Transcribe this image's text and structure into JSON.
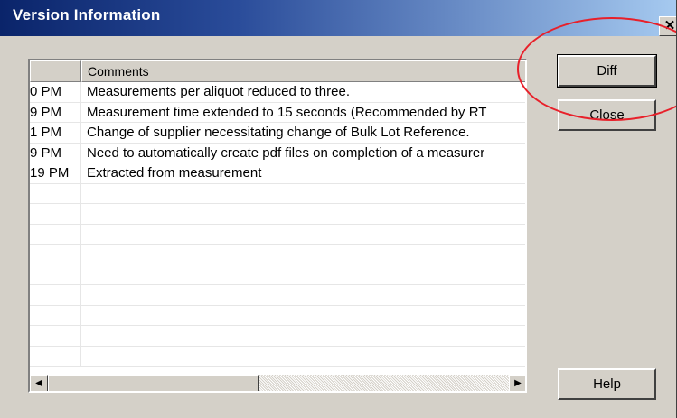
{
  "window": {
    "title": "Version Information",
    "close_glyph": "✕"
  },
  "list": {
    "columns": [
      "",
      "Comments"
    ],
    "rows": [
      {
        "time": "0 PM",
        "comment": "Measurements per aliquot reduced to three."
      },
      {
        "time": "9 PM",
        "comment": "Measurement time extended to 15 seconds (Recommended by RT"
      },
      {
        "time": "1 PM",
        "comment": "Change of supplier necessitating change of Bulk Lot Reference."
      },
      {
        "time": "9 PM",
        "comment": "Need to automatically create pdf files on completion of a measurer"
      },
      {
        "time": "19 PM",
        "comment": "Extracted from measurement"
      },
      {
        "time": "",
        "comment": ""
      },
      {
        "time": "",
        "comment": ""
      },
      {
        "time": "",
        "comment": ""
      },
      {
        "time": "",
        "comment": ""
      },
      {
        "time": "",
        "comment": ""
      },
      {
        "time": "",
        "comment": ""
      },
      {
        "time": "",
        "comment": ""
      },
      {
        "time": "",
        "comment": ""
      },
      {
        "time": "",
        "comment": ""
      }
    ],
    "scroll_left_glyph": "◀",
    "scroll_right_glyph": "▶"
  },
  "buttons": {
    "diff": "Diff",
    "close": "Close",
    "help": "Help"
  },
  "annotation": {
    "color": "#e8202a",
    "icon": "red-ellipse-highlight"
  }
}
